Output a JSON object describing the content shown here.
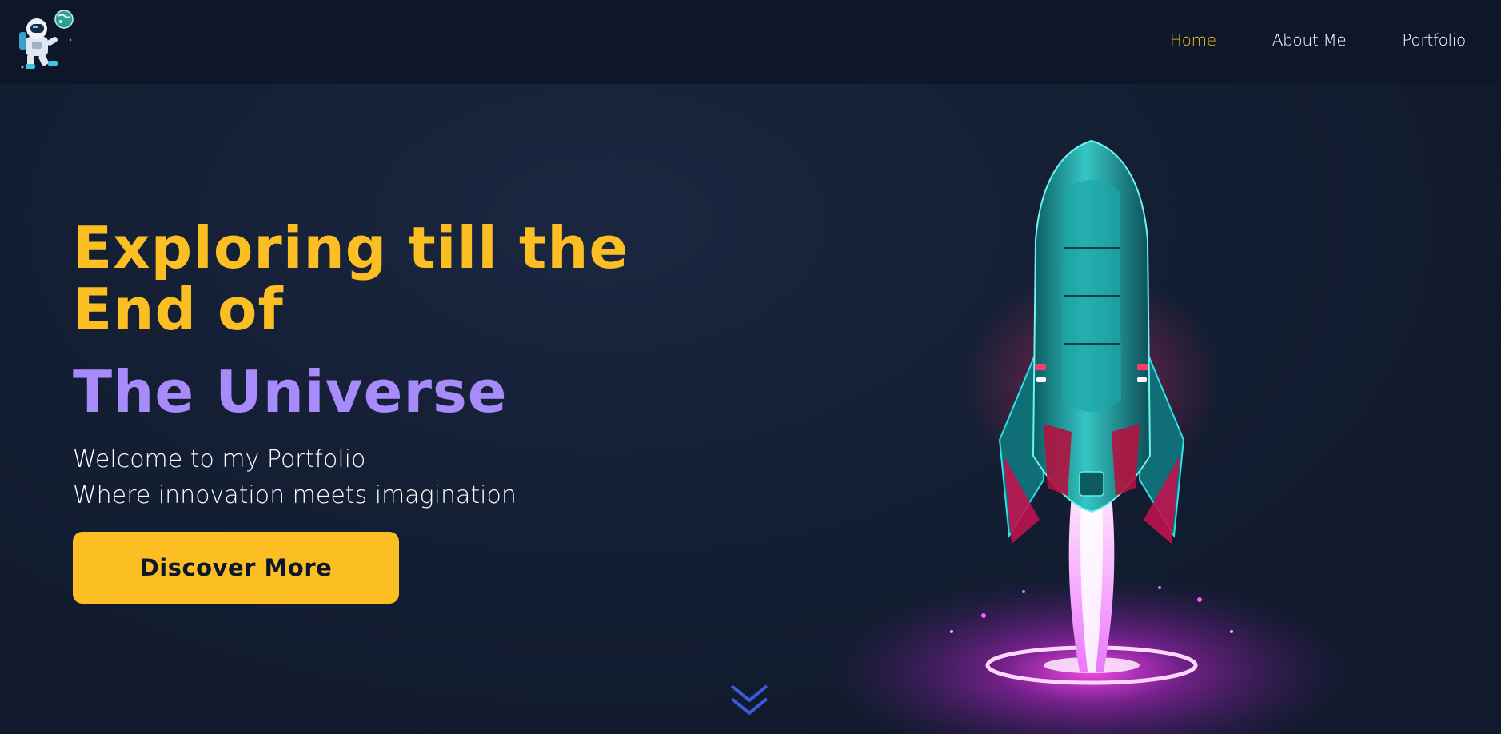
{
  "nav": {
    "logo_alt": "astronaut-logo",
    "links": [
      {
        "label": "Home",
        "active": true
      },
      {
        "label": "About Me",
        "active": false
      },
      {
        "label": "Portfolio",
        "active": false
      }
    ]
  },
  "hero": {
    "title_line1a": "Exploring till the",
    "title_line1b": "End of",
    "title_line2": "The Universe",
    "welcome_line1": "Welcome to my Portfolio",
    "welcome_line2": "Where innovation meets imagination",
    "cta_label": "Discover More"
  },
  "colors": {
    "accent_yellow": "#fbbf24",
    "accent_purple": "#a78bfa",
    "nav_bg": "#0e1729",
    "page_bg": "#152036",
    "scroll_icon": "#3b5bdb"
  },
  "icons": {
    "logo": "astronaut-icon",
    "hero_art": "rocket-illustration",
    "scroll": "double-chevron-down-icon"
  }
}
